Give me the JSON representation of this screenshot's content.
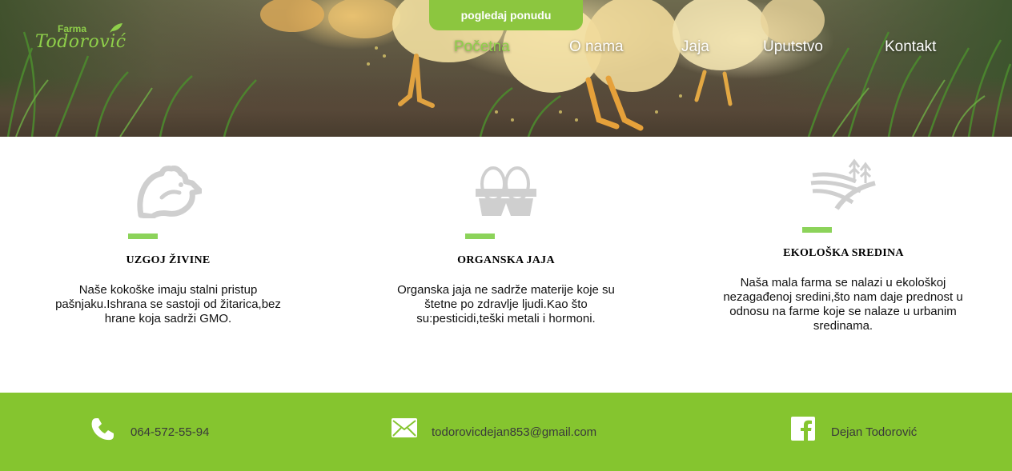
{
  "header": {
    "logo": {
      "small": "Farma",
      "name": "Todorović"
    },
    "offer_button": "pogledaj ponudu",
    "nav": [
      {
        "label": "Početna",
        "active": true
      },
      {
        "label": "O nama",
        "active": false
      },
      {
        "label": "Jaja",
        "active": false
      },
      {
        "label": "Uputstvo",
        "active": false
      },
      {
        "label": "Kontakt",
        "active": false
      }
    ],
    "colors": {
      "accent": "#8cc63f",
      "active_nav": "#8fd04a"
    }
  },
  "features": [
    {
      "icon": "chicken-icon",
      "title": "UZGOJ ŽIVINE",
      "text": "Naše kokoške imaju stalni pristup pašnjaku.Ishrana se sastoji od žitarica,bez hrane koja sadrži GMO."
    },
    {
      "icon": "egg-carton-icon",
      "title": "ORGANSKA JAJA",
      "text": "Organska jaja ne sadrže materije koje su štetne po zdravlje ljudi.Kao što su:pesticidi,teški metali i hormoni."
    },
    {
      "icon": "field-icon",
      "title": "EKOLOŠKA SREDINA",
      "text": "Naša mala farma se nalazi u ekološkoj nezagađenoj sredini,što nam daje prednost u odnosu na farme koje se nalaze u urbanim sredinama."
    }
  ],
  "footer": {
    "phone": {
      "icon": "phone-icon",
      "text": "064-572-55-94"
    },
    "email": {
      "icon": "envelope-icon",
      "text": "todorovicdejan853@gmail.com"
    },
    "facebook": {
      "icon": "facebook-icon",
      "text": "Dejan Todorović"
    },
    "colors": {
      "background": "#85c52f"
    }
  }
}
